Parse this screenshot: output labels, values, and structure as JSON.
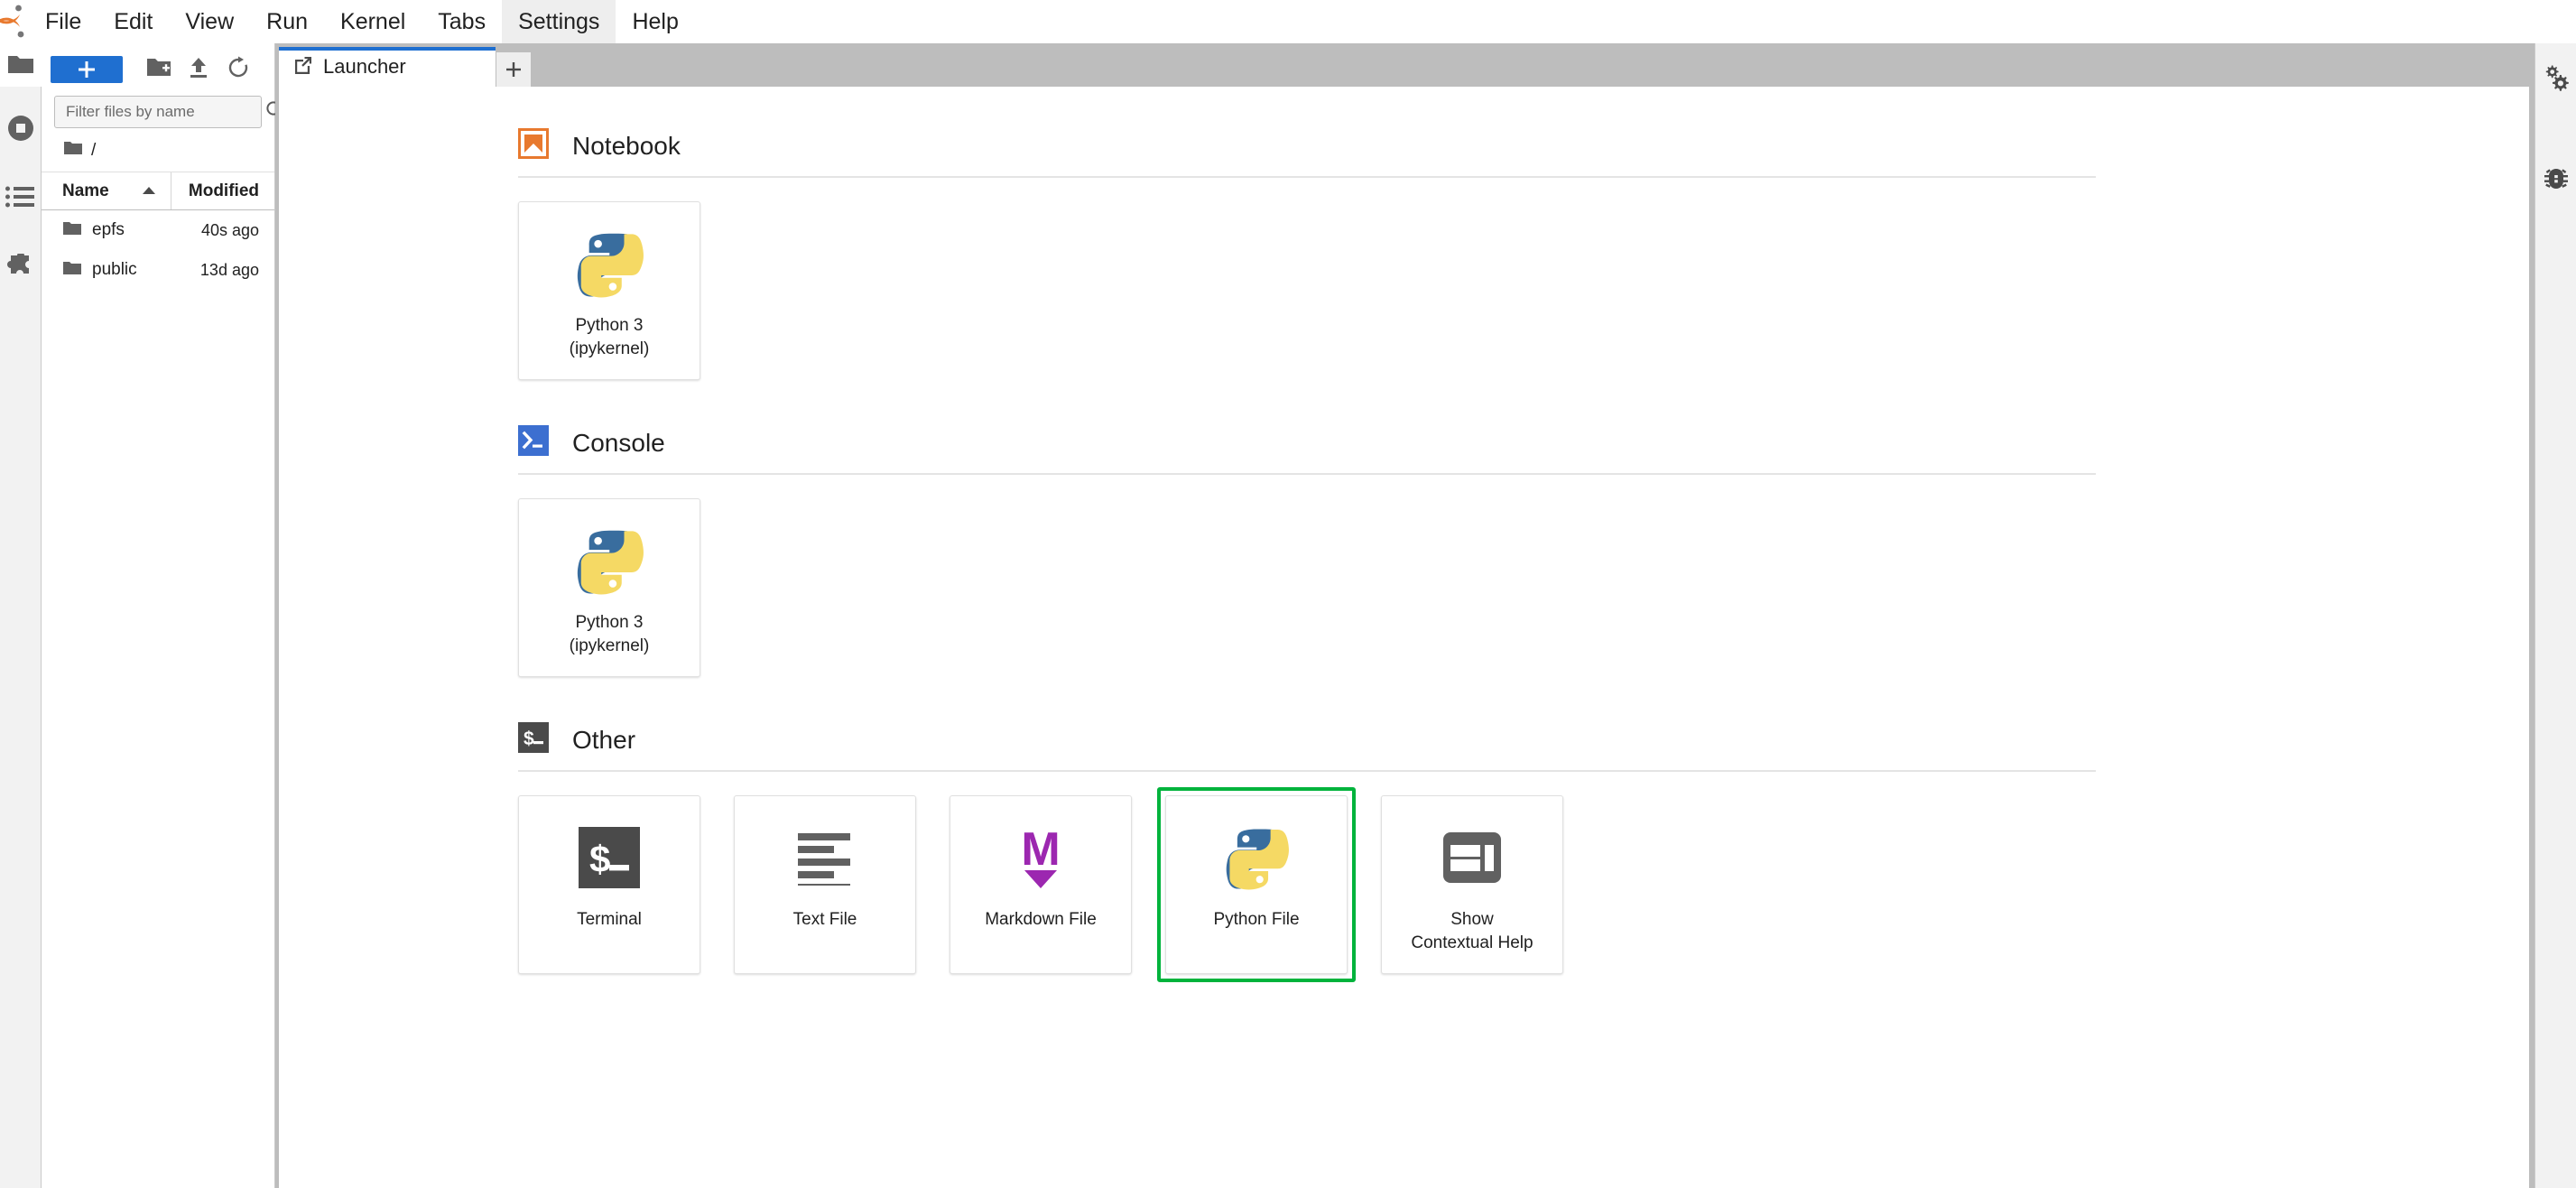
{
  "app": {
    "logo_icon": "jupyter-logo"
  },
  "menubar": {
    "items": [
      {
        "label": "File",
        "active": false
      },
      {
        "label": "Edit",
        "active": false
      },
      {
        "label": "View",
        "active": false
      },
      {
        "label": "Run",
        "active": false
      },
      {
        "label": "Kernel",
        "active": false
      },
      {
        "label": "Tabs",
        "active": false
      },
      {
        "label": "Settings",
        "active": true
      },
      {
        "label": "Help",
        "active": false
      }
    ]
  },
  "left_rail": {
    "items": [
      {
        "icon": "folder-icon",
        "name": "file-browser",
        "selected": true
      },
      {
        "icon": "running-sessions-icon",
        "name": "running-terminals-kernels",
        "selected": false
      },
      {
        "icon": "commands-list-icon",
        "name": "commands",
        "selected": false
      },
      {
        "icon": "puzzle-icon",
        "name": "extension-manager",
        "selected": false
      }
    ]
  },
  "right_rail": {
    "items": [
      {
        "icon": "gears-icon",
        "name": "property-inspector"
      },
      {
        "icon": "bug-icon",
        "name": "debugger"
      }
    ]
  },
  "filebrowser": {
    "toolbar": {
      "new_launcher_label": "+",
      "new_folder_icon": "new-folder-icon",
      "upload_icon": "upload-icon",
      "refresh_icon": "refresh-icon"
    },
    "filter": {
      "placeholder": "Filter files by name",
      "value": "",
      "search_icon": "search-icon"
    },
    "breadcrumb": {
      "root_icon": "folder-icon",
      "path": "/"
    },
    "columns": {
      "name": "Name",
      "modified": "Modified",
      "sort_icon": "sort-ascending-icon"
    },
    "rows": [
      {
        "icon": "folder-icon",
        "name": "epfs",
        "modified": "40s ago"
      },
      {
        "icon": "folder-icon",
        "name": "public",
        "modified": "13d ago"
      }
    ]
  },
  "dock": {
    "tabs": [
      {
        "label": "Launcher",
        "icon": "launcher-icon",
        "active": true
      }
    ],
    "add_tab_label": "+"
  },
  "launcher": {
    "sections": [
      {
        "title": "Notebook",
        "icon": "notebook-bookmark-icon",
        "icon_color": "#e8792e",
        "cards": [
          {
            "label": "Python 3\n(ipykernel)",
            "label_line1": "Python 3",
            "label_line2": "(ipykernel)",
            "icon": "python-logo-icon",
            "focused": false
          }
        ]
      },
      {
        "title": "Console",
        "icon": "console-prompt-icon",
        "icon_color": "#3c6fd0",
        "cards": [
          {
            "label": "Python 3\n(ipykernel)",
            "label_line1": "Python 3",
            "label_line2": "(ipykernel)",
            "icon": "python-logo-icon",
            "focused": false
          }
        ]
      },
      {
        "title": "Other",
        "icon": "terminal-dollar-icon",
        "icon_color": "#4a4a4a",
        "cards": [
          {
            "label_line1": "Terminal",
            "label_line2": "",
            "icon": "terminal-dollar-icon",
            "focused": false
          },
          {
            "label_line1": "Text File",
            "label_line2": "",
            "icon": "text-lines-icon",
            "focused": false
          },
          {
            "label_line1": "Markdown File",
            "label_line2": "",
            "icon": "markdown-m-icon",
            "focused": false
          },
          {
            "label_line1": "Python File",
            "label_line2": "",
            "icon": "python-logo-icon",
            "focused": true
          },
          {
            "label_line1": "Show",
            "label_line2": "Contextual Help",
            "icon": "contextual-help-panel-icon",
            "focused": false
          }
        ]
      }
    ]
  },
  "colors": {
    "accent_blue": "#1f6fd0",
    "focus_green": "#00b33c",
    "notebook_orange": "#e8792e",
    "console_blue": "#3c6fd0",
    "other_dark": "#4a4a4a",
    "markdown_purple": "#9c27b0",
    "python_blue": "#396d9e",
    "python_yellow": "#f5d964"
  }
}
